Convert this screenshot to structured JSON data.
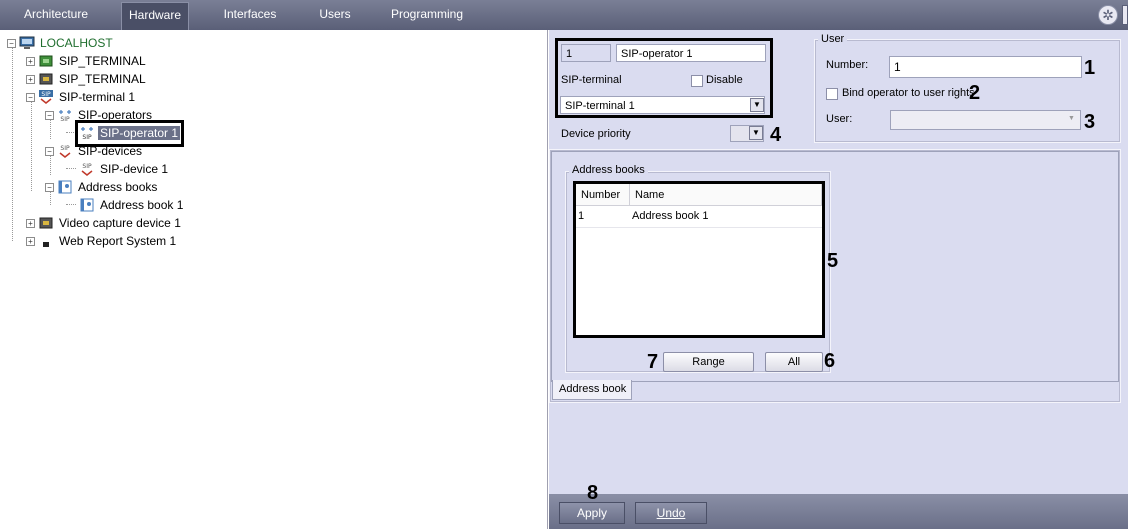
{
  "top_tabs": [
    {
      "label": "Architecture"
    },
    {
      "label": "Hardware",
      "active": true
    },
    {
      "label": "Interfaces"
    },
    {
      "label": "Users"
    },
    {
      "label": "Programming"
    }
  ],
  "tree": {
    "root": "LOCALHOST",
    "items": [
      {
        "label": "SIP_TERMINAL"
      },
      {
        "label": "SIP_TERMINAL"
      },
      {
        "label": "SIP-terminal 1"
      },
      {
        "label": "SIP-operators"
      },
      {
        "label": "SIP-operator 1",
        "selected": true
      },
      {
        "label": "SIP-devices"
      },
      {
        "label": "SIP-device 1"
      },
      {
        "label": "Address books"
      },
      {
        "label": "Address book 1"
      },
      {
        "label": "Video capture device 1"
      },
      {
        "label": "Web Report System 1"
      }
    ]
  },
  "object": {
    "id": "1",
    "name": "SIP-operator 1",
    "sip_terminal_label": "SIP-terminal",
    "disable_label": "Disable",
    "sip_terminal_value": "SIP-terminal 1",
    "device_priority_label": "Device priority",
    "device_priority_value": ""
  },
  "user_group": {
    "title": "User",
    "number_label": "Number:",
    "number_value": "1",
    "bind_label": "Bind operator to user rights",
    "user_label": "User:",
    "user_value": ""
  },
  "address_books": {
    "title": "Address books",
    "columns": [
      "Number",
      "Name"
    ],
    "rows": [
      {
        "number": "1",
        "name": "Address book 1"
      }
    ],
    "range_button": "Range",
    "all_button": "All",
    "tab_label": "Address book"
  },
  "callouts": [
    "1",
    "2",
    "3",
    "4",
    "5",
    "6",
    "7",
    "8"
  ],
  "footer": {
    "apply_label": "Apply",
    "undo_label": "Undo"
  },
  "colors": {
    "topbar": "#6a6f88",
    "panel_bg": "#dadcf0",
    "selection": "#6a7088",
    "tree_root_text": "#1f6e2e"
  }
}
